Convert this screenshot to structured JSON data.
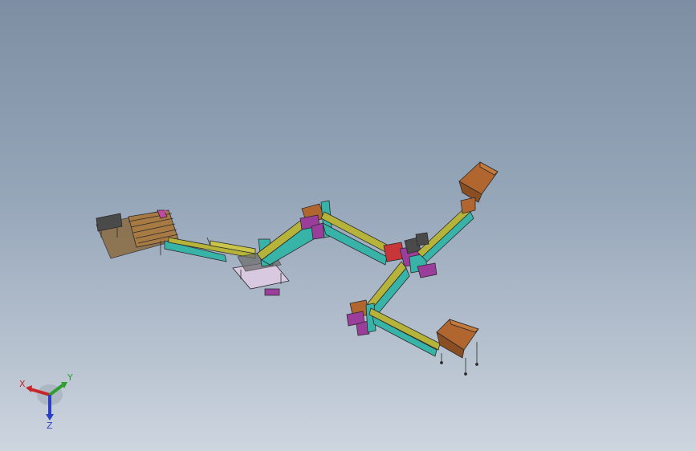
{
  "viewport": {
    "background_top": "#7d8ea3",
    "background_bottom": "#cdd5df"
  },
  "colors": {
    "conveyor_belt": "#b5b33a",
    "frame_teal": "#38b3a8",
    "drive_magenta": "#9b3e9b",
    "hopper_brown": "#b0662e",
    "motor_red": "#c8363a",
    "outline": "#2a2a2a"
  },
  "triad": {
    "x_label": "X",
    "y_label": "Y",
    "z_label": "Z",
    "x_color": "#c8262a",
    "y_color": "#2e9e2e",
    "z_color": "#2a3fc2"
  }
}
